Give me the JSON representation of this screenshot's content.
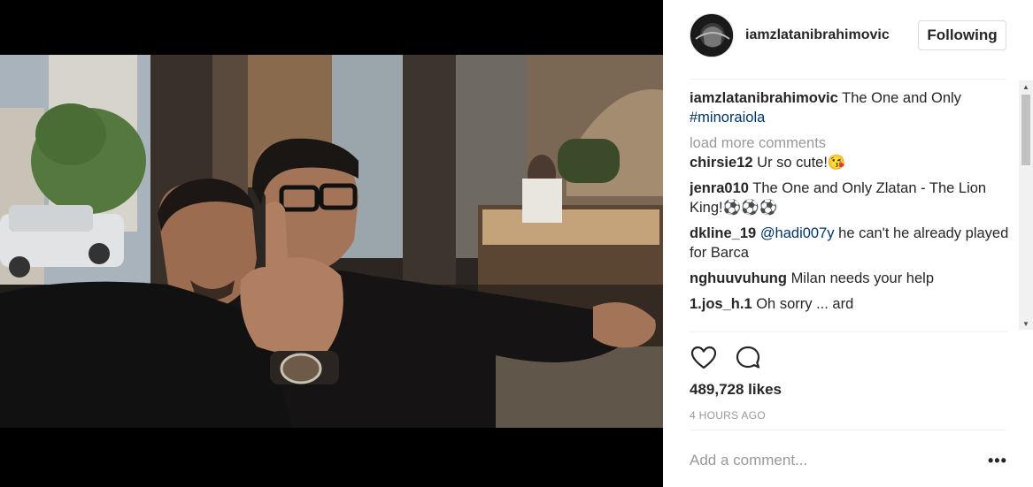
{
  "post": {
    "author": "iamzlatanibrahimovic",
    "follow_label": "Following",
    "caption_user": "iamzlatanibrahimovic",
    "caption_text": "The One and Only",
    "caption_tag": "#minoraiola",
    "load_more": "load more comments",
    "comments": [
      {
        "user": "chirsie12",
        "text": "Ur so cute!😘"
      },
      {
        "user": "jenra010",
        "text": "The One and Only Zlatan - The Lion King!⚽⚽⚽"
      },
      {
        "user": "dkline_19",
        "mention": "@hadi007y",
        "text": "he can't he already played for Barca"
      },
      {
        "user": "nghuuvuhung",
        "text": "Milan needs your help"
      },
      {
        "user": "1.jos_h.1",
        "text": "Oh sorry ... ard"
      }
    ],
    "likes": "489,728 likes",
    "time": "4 HOURS AGO",
    "comment_placeholder": "Add a comment...",
    "more_label": "•••"
  },
  "icons": {
    "like": "heart-icon",
    "comment": "speech-bubble-icon",
    "more": "ellipsis-icon"
  }
}
